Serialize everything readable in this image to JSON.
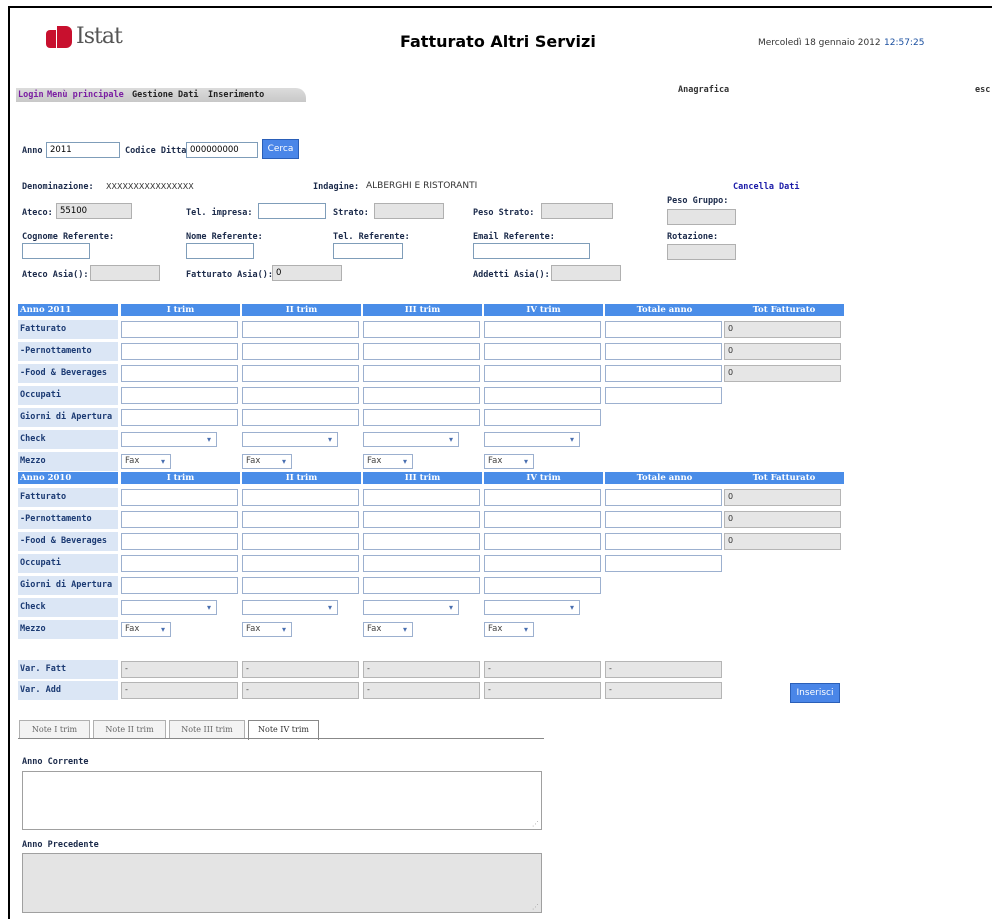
{
  "header": {
    "logo": "Istat",
    "title": "Fatturato Altri Servizi",
    "date": "Mercoledì 18 gennaio 2012",
    "time": "12:57:25",
    "anagrafica": "Anagrafica",
    "esc": "esc"
  },
  "nav": [
    "Login",
    "Menù principale",
    "Gestione Dati",
    "Inserimento"
  ],
  "search": {
    "anno_label": "Anno",
    "anno_value": "2011",
    "codice_label": "Codice Ditta",
    "codice_value": "000000000",
    "button": "Cerca"
  },
  "info": {
    "denominazione_label": "Denominazione:",
    "denominazione_value": "XXXXXXXXXXXXXXXX",
    "indagine_label": "Indagine:",
    "indagine_value": "ALBERGHI E RISTORANTI",
    "cancella": "Cancella Dati",
    "ateco_label": "Ateco:",
    "ateco_value": "55100",
    "tel_impresa_label": "Tel. impresa:",
    "strato_label": "Strato:",
    "peso_strato_label": "Peso Strato:",
    "peso_gruppo_label": "Peso Gruppo:",
    "cognome_label": "Cognome Referente:",
    "nome_label": "Nome Referente:",
    "tel_ref_label": "Tel. Referente:",
    "email_label": "Email Referente:",
    "rotazione_label": "Rotazione:",
    "ateco_asia_label": "Ateco Asia():",
    "fatturato_asia_label": "Fatturato Asia():",
    "fatturato_asia_value": "0",
    "addetti_asia_label": "Addetti Asia():"
  },
  "table": {
    "columns": [
      "I trim",
      "II trim",
      "III trim",
      "IV trim",
      "Totale anno",
      "Tot Fatturato"
    ],
    "blocks": [
      {
        "year": "Anno 2011",
        "rows": [
          "Fatturato",
          "-Pernottamento",
          "-Food & Beverages",
          "Occupati",
          "Giorni di Apertura",
          "Check",
          "Mezzo"
        ],
        "tot": [
          "0",
          "0",
          "0"
        ]
      },
      {
        "year": "Anno 2010",
        "rows": [
          "Fatturato",
          "-Pernottamento",
          "-Food & Beverages",
          "Occupati",
          "Giorni di Apertura",
          "Check",
          "Mezzo"
        ],
        "tot": [
          "0",
          "0",
          "0"
        ]
      }
    ],
    "mezzo_value": "Fax",
    "var_rows": [
      "Var. Fatt",
      "Var. Add"
    ],
    "var_value": "-",
    "inserisci": "Inserisci"
  },
  "notes": {
    "tabs": [
      "Note I trim",
      "Note II trim",
      "Note III trim",
      "Note IV trim"
    ],
    "anno_corrente": "Anno Corrente",
    "anno_precedente": "Anno Precedente"
  },
  "colors": {
    "accent": "#4a8de8",
    "logo": "#c8102e",
    "link": "#7b1fa2"
  }
}
